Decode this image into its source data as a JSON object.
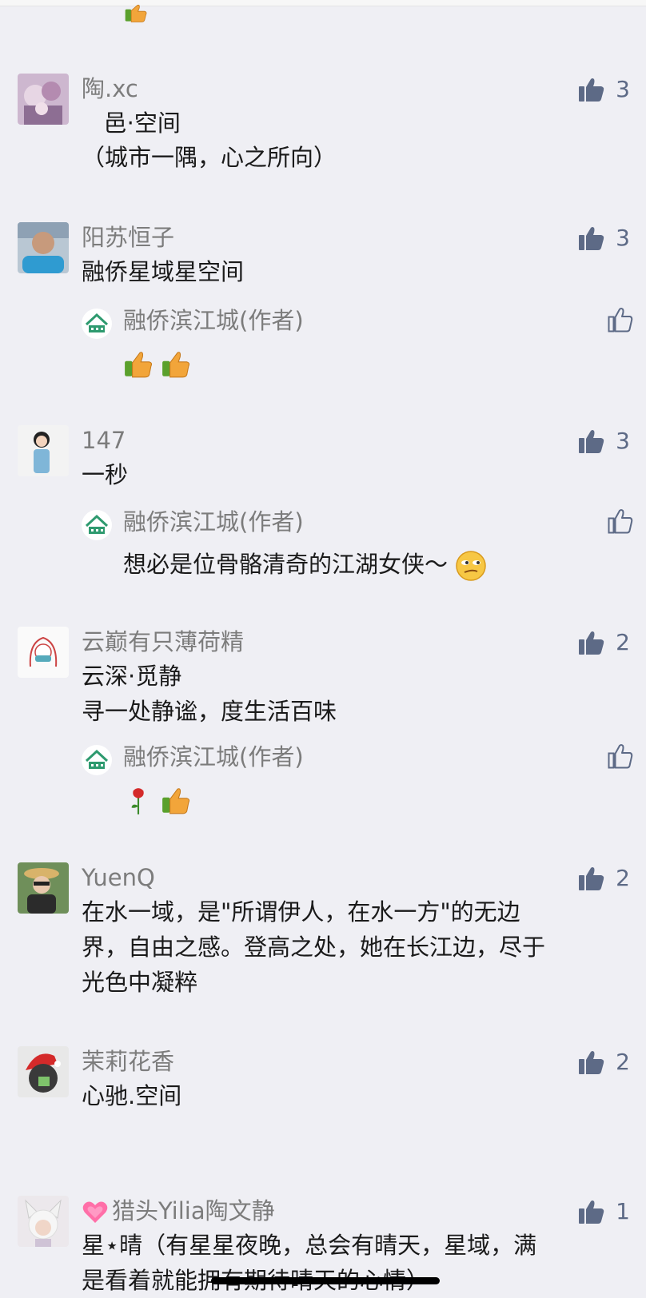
{
  "comments": [
    {
      "name": "陶.xc",
      "likes": "3",
      "lines": [
        "   邑·空间",
        "（城市一隅，心之所向）"
      ]
    },
    {
      "name": "阳苏恒子",
      "likes": "3",
      "lines": [
        "融侨星域星空间"
      ]
    },
    {
      "name": "147",
      "likes": "3",
      "lines": [
        "一秒"
      ]
    },
    {
      "name": "云巅有只薄荷精",
      "likes": "2",
      "lines": [
        "云深·觅静",
        "寻一处静谧，度生活百味"
      ]
    },
    {
      "name": "YuenQ",
      "likes": "2",
      "lines": [
        "在水一域，是\"所谓伊人，在水一方\"的无边",
        "界，自由之感。登高之处，她在长江边，尽于",
        "光色中凝粹"
      ]
    },
    {
      "name": "茉莉花香",
      "likes": "2",
      "lines": [
        "心驰.空间"
      ]
    },
    {
      "name": "猎头Yilia陶文静",
      "likes": "1",
      "lines": [
        "星⋆晴（有星星夜晚，总会有晴天，星域，满",
        "是看着就能拥有期待晴天的心情）"
      ]
    }
  ],
  "replies": [
    {
      "name": "融侨滨江城(作者)",
      "text": ""
    },
    {
      "name": "融侨滨江城(作者)",
      "text": "想必是位骨骼清奇的江湖女侠～"
    },
    {
      "name": "融侨滨江城(作者)",
      "text": ""
    }
  ],
  "icons": {
    "like": "thumbs-up-icon",
    "like_outline": "thumbs-up-outline-icon"
  },
  "colors": {
    "background": "#efeff4",
    "like_icon": "#5d6a86",
    "name": "#7c7c7c",
    "text": "#1a1a1a"
  }
}
